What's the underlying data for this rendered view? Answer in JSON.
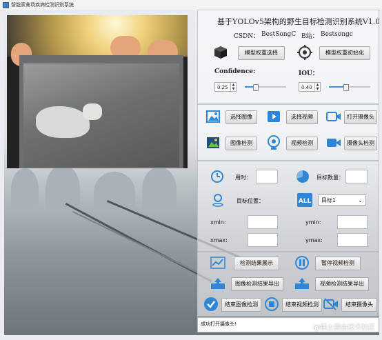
{
  "window": {
    "title": "智能家禽场疾病检测识别系统"
  },
  "header": {
    "title": "基于YOLOv5架构的野生目标检测识别系统V1.0",
    "csdn_label": "CSDN：",
    "csdn_value": "BestSongC",
    "bili_label": "B站：",
    "bili_value": "Bestsongc"
  },
  "model": {
    "select_weights": "模型权重选择",
    "init_weights": "模型权重初始化",
    "confidence_label": "Confidence:",
    "confidence_value": "0.25",
    "confidence_level": 0.25,
    "iou_label": "IOU：",
    "iou_value": "0.40",
    "iou_level": 0.4
  },
  "inputs": {
    "select_image": "选择图像",
    "select_video": "选择视频",
    "open_camera": "打开摄像头",
    "image_detect": "图像检测",
    "video_detect": "视频检测",
    "camera_detect": "摄像头检测"
  },
  "stats": {
    "time_label": "用时：",
    "count_label": "目标数量：",
    "position_label": "目标位置：",
    "target_select": "目标1",
    "xmin_label": "xmin:",
    "ymin_label": "ymin:",
    "xmax_label": "xmax:",
    "ymax_label": "ymax:"
  },
  "actions": {
    "show_results": "检测结果展示",
    "pause_video": "暂停视频检测",
    "export_image": "图像检测结果导出",
    "export_video": "视频检测结果导出",
    "end_image": "结束图像检测",
    "end_video": "结束视频检测",
    "end_camera": "结束摄像头"
  },
  "status": {
    "message": "成功打开摄像头!"
  },
  "watermark": "@稀土掘金技术社区",
  "colors": {
    "accent": "#2f86d6",
    "highlight": "#4a90d9"
  }
}
